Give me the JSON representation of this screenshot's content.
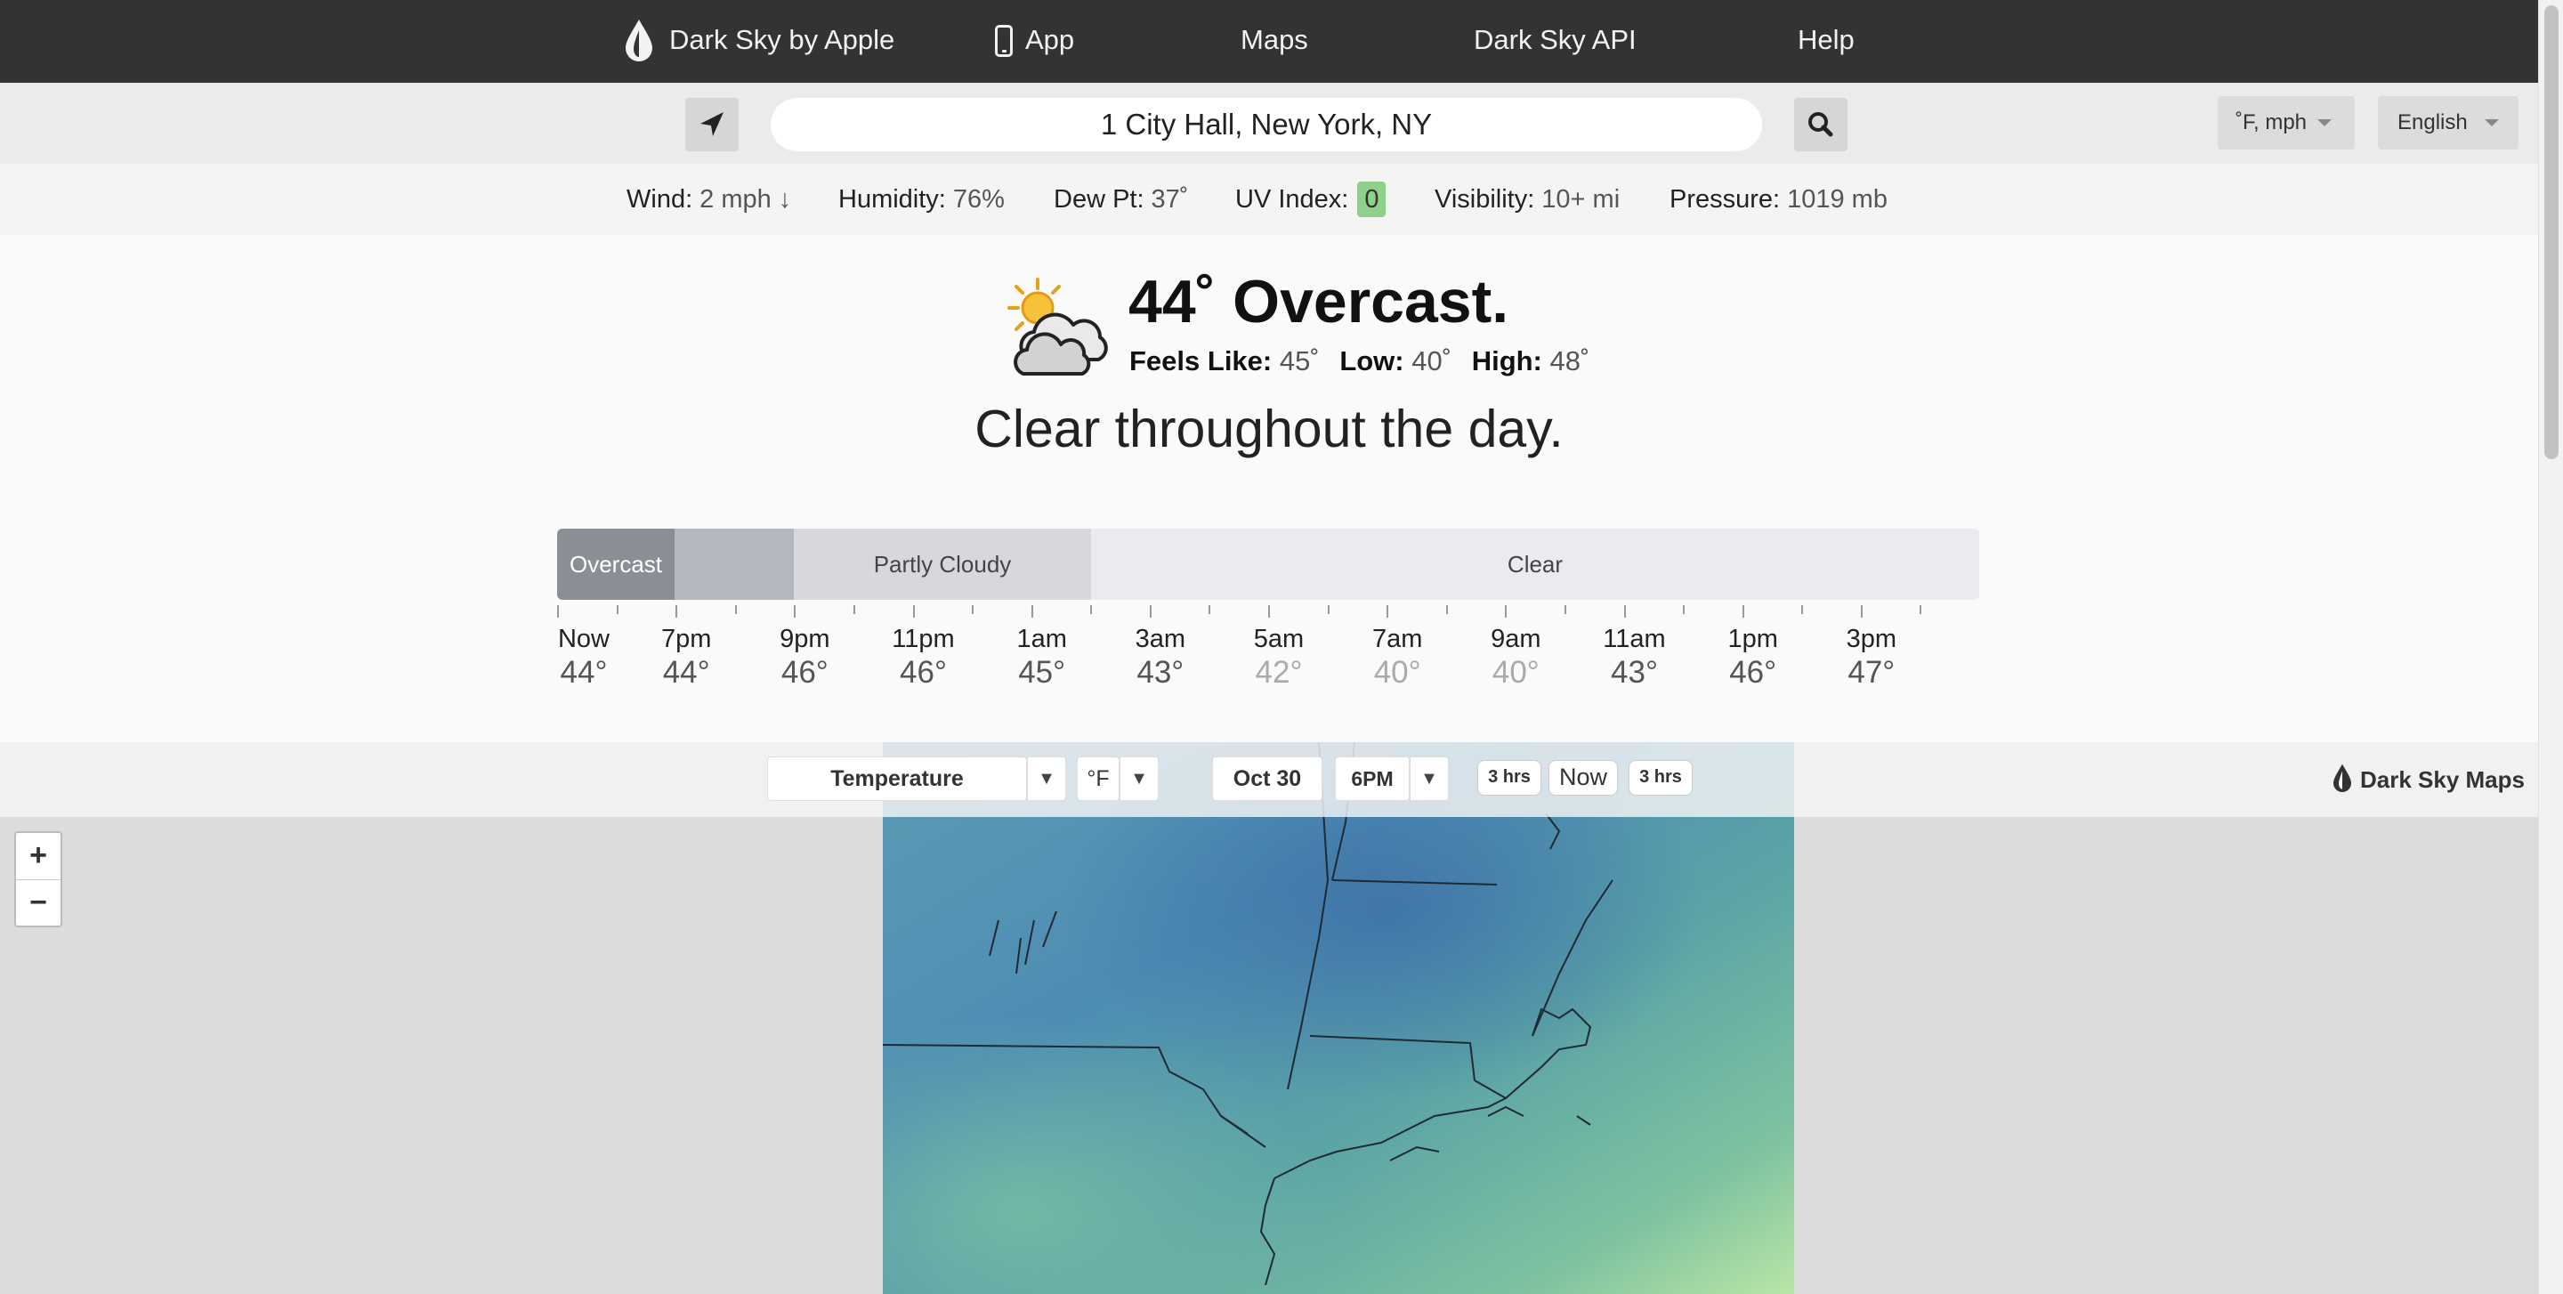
{
  "nav": {
    "brand": "Dark Sky by Apple",
    "app": "App",
    "maps": "Maps",
    "api": "Dark Sky API",
    "help": "Help"
  },
  "search": {
    "value": "1 City Hall, New York, NY",
    "units_label": "˚F, mph",
    "language_label": "English"
  },
  "details": {
    "wind_label": "Wind:",
    "wind_value": "2 mph ↓",
    "humidity_label": "Humidity:",
    "humidity_value": "76%",
    "dew_label": "Dew Pt:",
    "dew_value": "37˚",
    "uv_label": "UV Index:",
    "uv_value": "0",
    "visibility_label": "Visibility:",
    "visibility_value": "10+ mi",
    "pressure_label": "Pressure:",
    "pressure_value": "1019 mb"
  },
  "current": {
    "title": "44˚ Overcast.",
    "feels_label": "Feels Like:",
    "feels_value": "45˚",
    "low_label": "Low:",
    "low_value": "40˚",
    "high_label": "High:",
    "high_value": "48˚",
    "day_summary": "Clear throughout the day."
  },
  "timeline": {
    "segments": [
      {
        "label": "Overcast",
        "color": "#8b8e95",
        "text_color": "#ffffff"
      },
      {
        "label": "",
        "color": "#b4b8c1",
        "text_color": "#333333"
      },
      {
        "label": "Partly Cloudy",
        "color": "#d6d8de",
        "text_color": "#444444"
      },
      {
        "label": "Clear",
        "color": "#ebebef",
        "text_color": "#444444"
      }
    ],
    "hours": [
      {
        "hour": "Now",
        "temp": "44°",
        "dim": false
      },
      {
        "hour": "7pm",
        "temp": "44°",
        "dim": false
      },
      {
        "hour": "9pm",
        "temp": "46°",
        "dim": false
      },
      {
        "hour": "11pm",
        "temp": "46°",
        "dim": false
      },
      {
        "hour": "1am",
        "temp": "45°",
        "dim": false
      },
      {
        "hour": "3am",
        "temp": "43°",
        "dim": false
      },
      {
        "hour": "5am",
        "temp": "42°",
        "dim": true
      },
      {
        "hour": "7am",
        "temp": "40°",
        "dim": true
      },
      {
        "hour": "9am",
        "temp": "40°",
        "dim": true
      },
      {
        "hour": "11am",
        "temp": "43°",
        "dim": false
      },
      {
        "hour": "1pm",
        "temp": "46°",
        "dim": false
      },
      {
        "hour": "3pm",
        "temp": "47°",
        "dim": false
      }
    ]
  },
  "map": {
    "layer": "Temperature",
    "unit": "°F",
    "date": "Oct 30",
    "time": "6PM",
    "back": "3 hrs",
    "now": "Now",
    "forward": "3 hrs",
    "brand": "Dark Sky Maps",
    "zoom_in": "+",
    "zoom_out": "−"
  }
}
